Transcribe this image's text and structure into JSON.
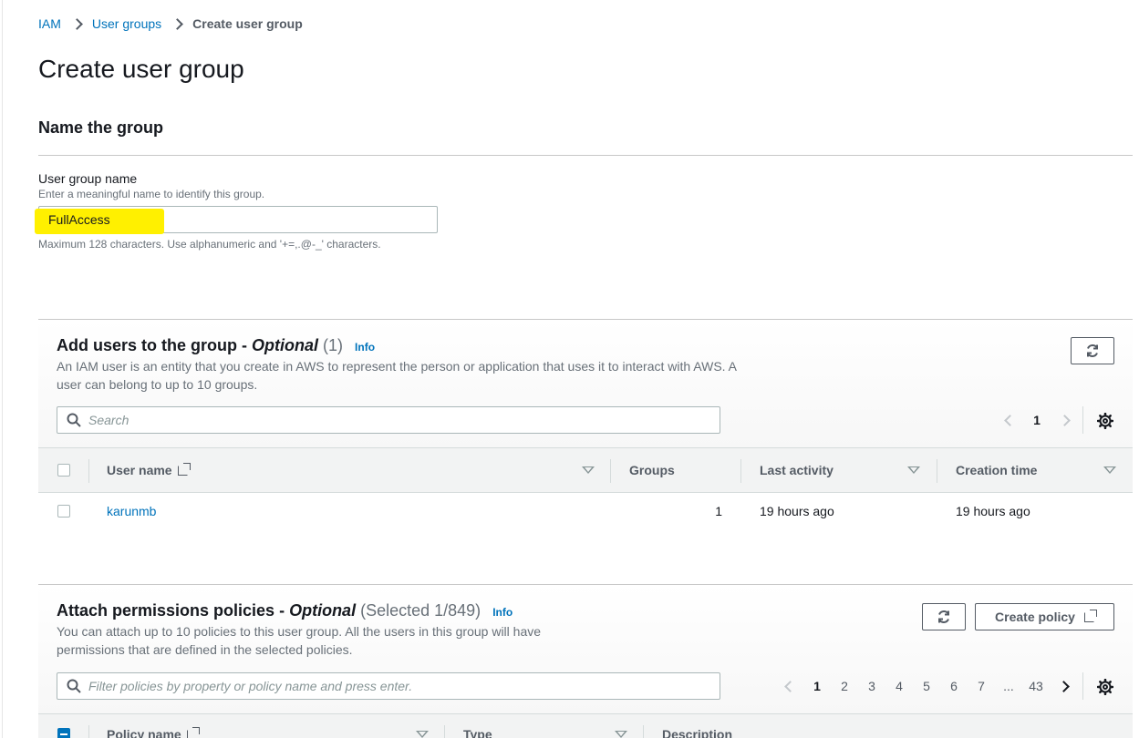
{
  "breadcrumb": {
    "items": [
      "IAM",
      "User groups"
    ],
    "current": "Create user group"
  },
  "page_title": "Create user group",
  "name_section": {
    "title": "Name the group",
    "label": "User group name",
    "description": "Enter a meaningful name to identify this group.",
    "value": "FullAccess",
    "constraint": "Maximum 128 characters. Use alphanumeric and '+=,.@-_' characters."
  },
  "users_panel": {
    "title": "Add users to the group - ",
    "optional": "Optional",
    "count": "(1)",
    "info": "Info",
    "description": "An IAM user is an entity that you create in AWS to represent the person or application that uses it to interact with AWS. A user can belong to up to 10 groups.",
    "search_placeholder": "Search",
    "page": "1",
    "columns": [
      "User name",
      "Groups",
      "Last activity",
      "Creation time"
    ],
    "rows": [
      {
        "user_name": "karunmb",
        "groups": "1",
        "last_activity": "19 hours ago",
        "creation_time": "19 hours ago"
      }
    ]
  },
  "policies_panel": {
    "title": "Attach permissions policies - ",
    "optional": "Optional",
    "count": "(Selected 1/849)",
    "info": "Info",
    "description": "You can attach up to 10 policies to this user group. All the users in this group will have permissions that are defined in the selected policies.",
    "create_policy_label": "Create policy",
    "filter_placeholder": "Filter policies by property or policy name and press enter.",
    "pages": [
      "1",
      "2",
      "3",
      "4",
      "5",
      "6",
      "7",
      "...",
      "43"
    ],
    "active_page": "1",
    "columns": [
      "Policy name",
      "Type",
      "Description"
    ]
  },
  "icons": {
    "refresh": "refresh-icon",
    "settings": "gear-icon",
    "search": "search-icon",
    "external_link": "external-link-icon"
  },
  "colors": {
    "link": "#0073bb",
    "highlight": "#fff000"
  }
}
